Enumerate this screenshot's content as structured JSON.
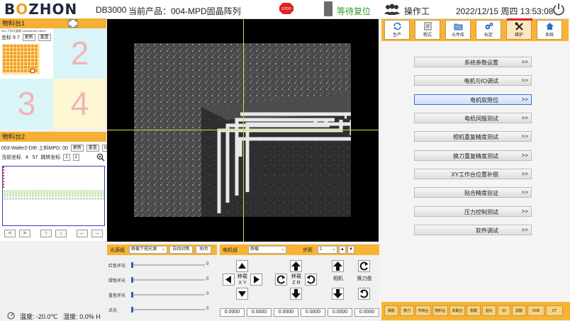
{
  "header": {
    "logo": "BOZHON",
    "model": "DB3000",
    "product": "当前产品：004-MPD固晶阵列",
    "stop_label": "STOP",
    "status": "等待复位",
    "operator": "操作工",
    "date": "2022/12/15",
    "weekday": "周四",
    "time": "13:53:08"
  },
  "stage1": {
    "title": "物料台1",
    "caption": "004-下料大晶地 Unload1Gel-10610",
    "coords_label": "坐标",
    "coord_x": "9",
    "coord_y": "7",
    "btn_update": "更新",
    "btn_reset": "重置",
    "quadrants": [
      "1",
      "2",
      "3",
      "4"
    ]
  },
  "stage2": {
    "title": "物料台2",
    "caption": "003-Wafer2-DIE-上料MPD: 00",
    "btn_update": "更新",
    "btn_reset": "重置",
    "btn_goto": "GoTo",
    "current_label": "当前坐标",
    "coord_x": "4",
    "coord_y": "57",
    "target_label": "跳转坐标",
    "target_x": "1",
    "target_y": "1"
  },
  "nav_buttons": [
    "<",
    ">",
    "↑",
    "↓",
    "←",
    "→"
  ],
  "env": {
    "temp_label": "温度:",
    "temp": "-20.0℃",
    "humidity_label": "湿度:",
    "humidity": "0.0% H"
  },
  "toolbar": {
    "items": [
      {
        "label": "生产",
        "icon": "refresh-icon"
      },
      {
        "label": "程式",
        "icon": "document-icon"
      },
      {
        "label": "元件库",
        "icon": "folder-icon"
      },
      {
        "label": "标定",
        "icon": "gears-icon"
      },
      {
        "label": "维护",
        "icon": "tools-icon"
      },
      {
        "label": "系统",
        "icon": "home-icon"
      }
    ],
    "active": "维护"
  },
  "menu": {
    "items": [
      "系统参数设置",
      "电机与IO调试",
      "电机软限位",
      "电机伺服测试",
      "相机重复精度测试",
      "换刀重复精度测试",
      "XY工作台位置补偿",
      "贴合精度验证",
      "压力控制测试",
      "软件调试"
    ],
    "arrow": ">>",
    "selected": "电机软限位"
  },
  "bottom_buttons": [
    "相机",
    "换刀",
    "中转台",
    "物料台",
    "夹取台",
    "看截",
    "贴片",
    "IO",
    "滤胶",
    "VDB",
    "CT"
  ],
  "light": {
    "title": "光源组",
    "source_value": "移载下视光源",
    "btn_auto": "自动对焦",
    "btn_off": "关闭",
    "sliders": [
      {
        "label": "红色环光",
        "value": "0"
      },
      {
        "label": "绿色环光",
        "value": "0"
      },
      {
        "label": "蓝色环光",
        "value": "0"
      },
      {
        "label": "点光",
        "value": "0"
      }
    ]
  },
  "motor": {
    "title": "电机组",
    "group_value": "移载",
    "step_label": "步距",
    "step_value": "1",
    "xy_label": "移载 X Y",
    "zr_label": "移载 Z R",
    "camera_label": "相机",
    "tool_label": "换刀盘",
    "coords": [
      "0.0000",
      "0.0000",
      "0.0000",
      "0.0000",
      "0.0000",
      "0.0000"
    ]
  }
}
